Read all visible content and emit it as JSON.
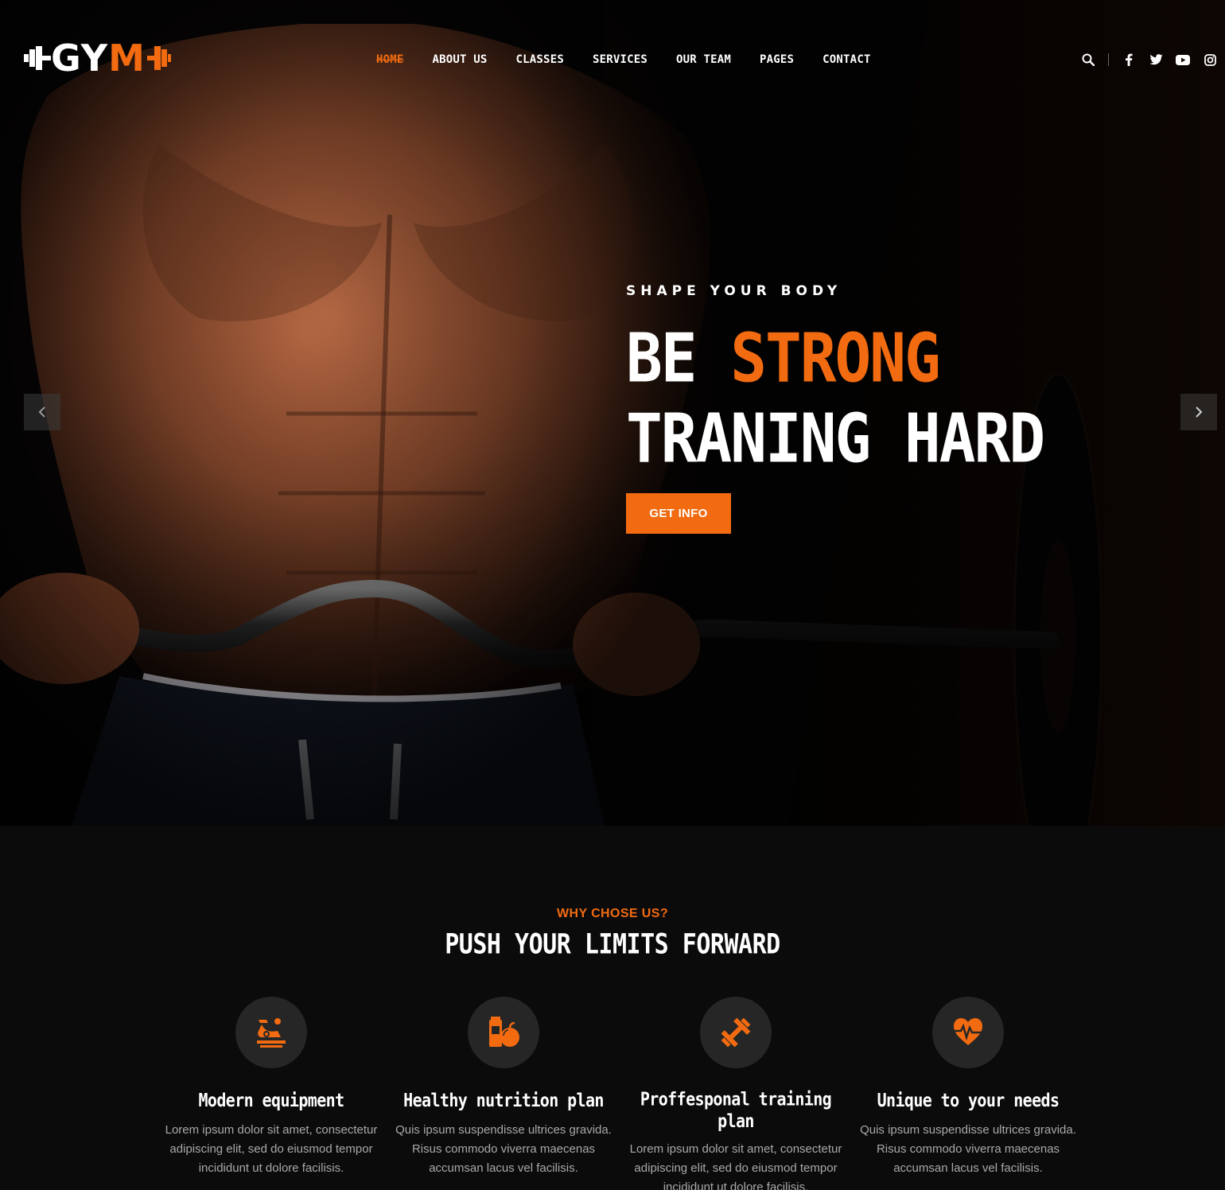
{
  "brand": {
    "logo_left": "GY",
    "logo_right": "M",
    "accent": "#f26b11"
  },
  "nav": {
    "items": [
      {
        "label": "HOME"
      },
      {
        "label": "ABOUT US"
      },
      {
        "label": "CLASSES"
      },
      {
        "label": "SERVICES"
      },
      {
        "label": "OUR TEAM"
      },
      {
        "label": "PAGES"
      },
      {
        "label": "CONTACT"
      }
    ],
    "active": "HOME"
  },
  "header_icons": [
    "search-icon",
    "facebook-icon",
    "twitter-icon",
    "youtube-icon",
    "instagram-icon"
  ],
  "hero": {
    "subtitle": "SHAPE YOUR BODY",
    "headline_line1_plain": "BE ",
    "headline_line1_accent": "STRONG",
    "headline_line2": "TRANING HARD",
    "button": "GET INFO",
    "prev_icon": "chevron-left-icon",
    "next_icon": "chevron-right-icon"
  },
  "why": {
    "kicker": "WHY CHOSE US?",
    "title": "PUSH YOUR LIMITS FORWARD",
    "features": [
      {
        "icon": "exercise-bike-icon",
        "title": "Modern equipment",
        "text": "Lorem ipsum dolor sit amet, consectetur adipiscing elit, sed do eiusmod tempor incididunt ut dolore facilisis."
      },
      {
        "icon": "nutrition-icon",
        "title": "Healthy nutrition plan",
        "text": "Quis ipsum suspendisse ultrices gravida. Risus commodo viverra maecenas accumsan lacus vel facilisis."
      },
      {
        "icon": "dumbbell-icon",
        "title": "Proffesponal training plan",
        "text": "Lorem ipsum dolor sit amet, consectetur adipiscing elit, sed do eiusmod tempor incididunt ut dolore facilisis."
      },
      {
        "icon": "heart-pulse-icon",
        "title": "Unique to your needs",
        "text": "Quis ipsum suspendisse ultrices gravida. Risus commodo viverra maecenas accumsan lacus vel facilisis."
      }
    ]
  }
}
